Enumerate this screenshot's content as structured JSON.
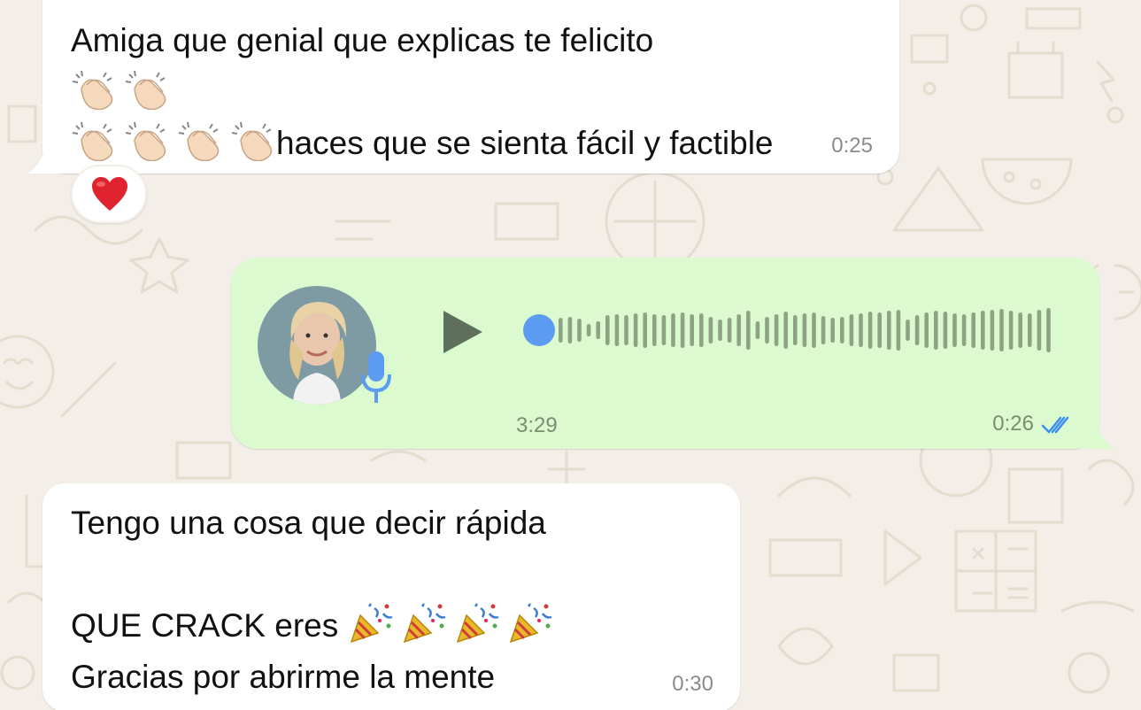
{
  "chat": {
    "messages": [
      {
        "direction": "incoming",
        "line1_text": "Amiga que genial que explicas te felicito",
        "line1_emoji_count": 2,
        "line2_emoji_count": 4,
        "line2_text": "haces que se sienta fácil y factible",
        "emoji": "clapping-hands",
        "time": "0:25",
        "reaction": "red-heart"
      },
      {
        "direction": "outgoing",
        "type": "voice",
        "duration": "3:29",
        "time": "0:26",
        "status": "read",
        "progress": 0
      },
      {
        "direction": "incoming",
        "line1_text": "Tengo una cosa que decir rápida",
        "line2_text": "QUE CRACK eres",
        "line2_emoji_count": 4,
        "line3_text": "Gracias por abrirme la mente",
        "emoji": "party-popper",
        "time": "0:30"
      }
    ]
  },
  "colors": {
    "chat_background": "#f3efe8",
    "incoming_bubble": "#ffffff",
    "outgoing_bubble": "#dcfad0",
    "read_ticks": "#3b8ef0",
    "voice_accent": "#5b9cf2",
    "waveform": "#8da383"
  }
}
